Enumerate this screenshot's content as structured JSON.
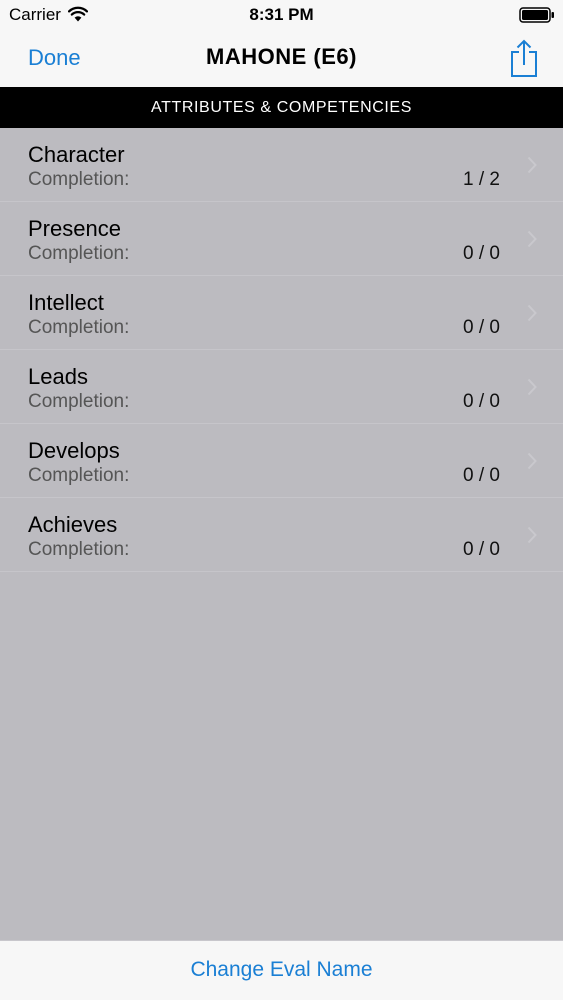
{
  "status_bar": {
    "carrier": "Carrier",
    "time": "8:31 PM",
    "icons": [
      "wifi-icon",
      "battery-icon"
    ]
  },
  "nav": {
    "done_label": "Done",
    "title": "MAHONE (E6)",
    "share_icon": "share-icon"
  },
  "section_header": "ATTRIBUTES & COMPETENCIES",
  "rows": [
    {
      "title": "Character",
      "subtitle": "Completion:",
      "count": "1 / 2"
    },
    {
      "title": "Presence",
      "subtitle": "Completion:",
      "count": "0 / 0"
    },
    {
      "title": "Intellect",
      "subtitle": "Completion:",
      "count": "0 / 0"
    },
    {
      "title": "Leads",
      "subtitle": "Completion:",
      "count": "0 / 0"
    },
    {
      "title": "Develops",
      "subtitle": "Completion:",
      "count": "0 / 0"
    },
    {
      "title": "Achieves",
      "subtitle": "Completion:",
      "count": "0 / 0"
    }
  ],
  "toolbar": {
    "button_label": "Change Eval Name"
  },
  "colors": {
    "accent": "#1a7fd4",
    "list_background": "#bcbbc0",
    "header_background": "#000000",
    "bar_background": "#f7f7f7"
  }
}
